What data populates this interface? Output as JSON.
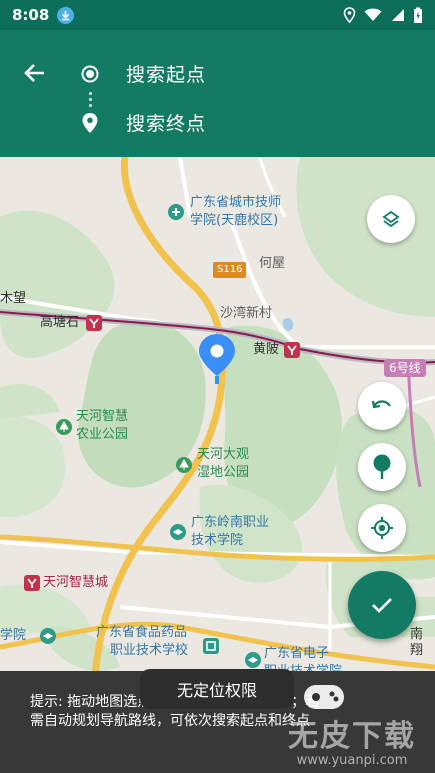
{
  "status": {
    "time": "8:08"
  },
  "header": {
    "start_label": "搜索起点",
    "end_label": "搜索终点"
  },
  "map": {
    "roads": {
      "s116": "S116",
      "line6": "6号线"
    },
    "places": {
      "tech_school": "广东省城市技师",
      "tech_school_2": "学院(天鹿校区)",
      "heiwu": "何屋",
      "shawan": "沙湾新村",
      "gaotangshi": "高塘石",
      "huangpi": "黄陂",
      "mushang": "木望",
      "tianhe_park": "天河智慧",
      "tianhe_park_2": "农业公园",
      "wetland": "天河大观",
      "wetland_2": "湿地公园",
      "lingnan": "广东岭南职业",
      "lingnan_2": "技术学院",
      "smart_city": "天河智慧城",
      "food_school": "广东省食品药品",
      "food_school_2": "职业技术学校",
      "electronics": "广东省电子",
      "electronics_2": "职业技术学院",
      "xueyuan": "学院",
      "nanxiang": "南翔"
    }
  },
  "toast": {
    "text": "无定位权限"
  },
  "hint": {
    "text": "提示: 拖动地图选点，或点击下方按钮定位；若需自动规划导航路线，可依次搜索起点和终点"
  },
  "watermark": {
    "brand": "无皮下载",
    "url": "www.yuanpi.com"
  },
  "colors": {
    "primary": "#137b63",
    "status": "#0d6e59",
    "panel": "#383838",
    "pin": "#3a8ef6"
  }
}
